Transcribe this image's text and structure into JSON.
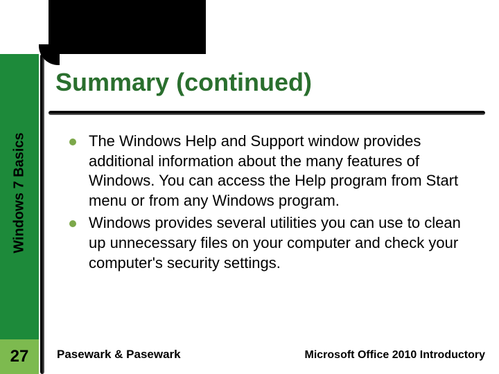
{
  "slide": {
    "title": "Summary (continued)",
    "side_label": "Windows 7 Basics",
    "page_number": "27",
    "bullets": [
      "The Windows Help and Support window provides additional information about the many features of Windows. You can access the Help program from Start menu or from any Windows program.",
      "Windows provides several utilities you can use to clean up unnecessary files on your computer and check your computer's security settings."
    ],
    "footer_left": "Pasewark & Pasewark",
    "footer_right": "Microsoft Office 2010 Introductory"
  },
  "colors": {
    "title_green": "#2a6f2e",
    "sidebar_green": "#1d8a3a",
    "accent_green": "#7dba4f",
    "bullet_green": "#7ca84a"
  }
}
